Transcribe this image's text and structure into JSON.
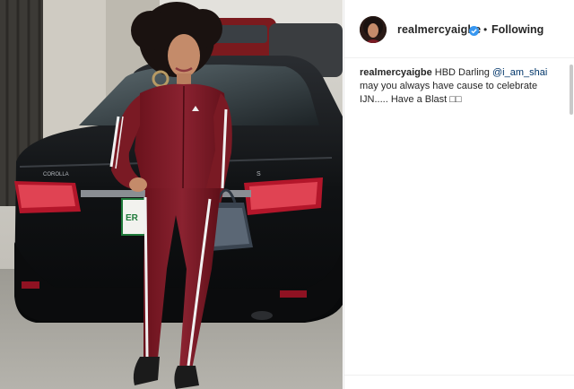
{
  "post": {
    "username": "realmercyaigbe",
    "follow_label": "Following",
    "separator": "•",
    "caption": {
      "username": "realmercyaigbe",
      "text_before": "HBD Darling ",
      "mention": "@i_am_shai",
      "text_after": " may you always have cause to celebrate IJN..... Have a Blast",
      "emojis": "□□"
    }
  },
  "photo": {
    "plate_text": "ER",
    "car_model": "COROLLA",
    "trim": "S"
  },
  "colors": {
    "tracksuit": "#7a1a24",
    "car": "#121416",
    "mention": "#003569",
    "verified": "#3897f0"
  },
  "icons": {
    "verified": "verified-badge-icon"
  }
}
